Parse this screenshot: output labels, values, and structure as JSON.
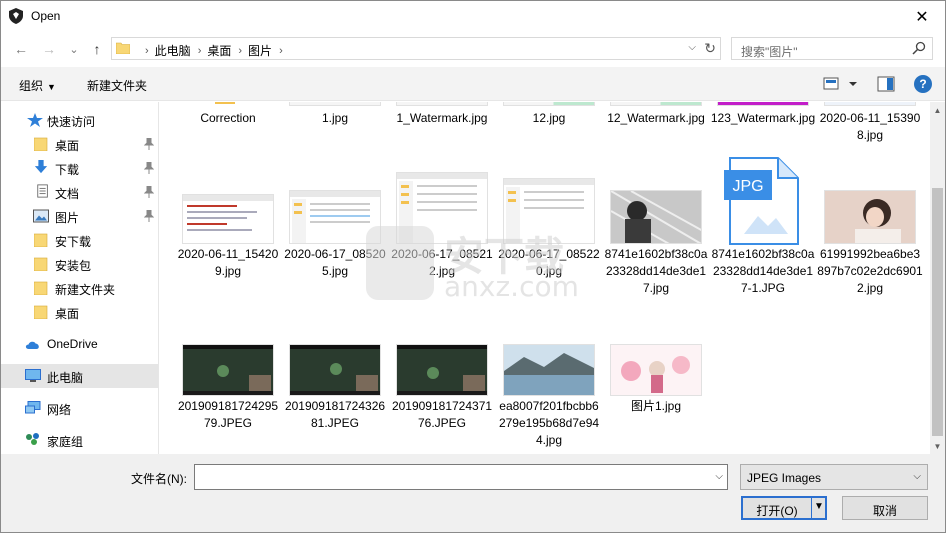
{
  "window": {
    "title": "Open",
    "close_glyph": "✕"
  },
  "nav": {
    "back_glyph": "←",
    "forward_glyph": "→",
    "recent_glyph": "⌄",
    "up_glyph": "↑",
    "breadcrumbs": [
      "此电脑",
      "桌面",
      "图片"
    ],
    "crumb_separator": "›",
    "search_placeholder": "搜索\"图片\""
  },
  "toolbar": {
    "organize_label": "组织",
    "new_folder_label": "新建文件夹",
    "help_label": "?"
  },
  "sidebar": {
    "items": [
      {
        "label": "快速访问",
        "icon": "star-icon",
        "pinned": false
      },
      {
        "label": "桌面",
        "icon": "folder-icon",
        "pinned": true
      },
      {
        "label": "下载",
        "icon": "download-icon",
        "pinned": true
      },
      {
        "label": "文档",
        "icon": "document-icon",
        "pinned": true
      },
      {
        "label": "图片",
        "icon": "pictures-icon",
        "pinned": true
      },
      {
        "label": "安下载",
        "icon": "folder-icon",
        "pinned": false
      },
      {
        "label": "安装包",
        "icon": "folder-icon",
        "pinned": false
      },
      {
        "label": "新建文件夹",
        "icon": "folder-icon",
        "pinned": false
      },
      {
        "label": "桌面",
        "icon": "folder-icon",
        "pinned": false
      },
      {
        "label": "OneDrive",
        "icon": "cloud-icon",
        "pinned": false
      },
      {
        "label": "此电脑",
        "icon": "computer-icon",
        "pinned": false,
        "selected": true
      },
      {
        "label": "网络",
        "icon": "network-icon",
        "pinned": false
      },
      {
        "label": "家庭组",
        "icon": "homegroup-icon",
        "pinned": false
      }
    ]
  },
  "files": {
    "row1": [
      "Correction",
      "1.jpg",
      "1_Watermark.jpg",
      "12.jpg",
      "12_Watermark.jpg",
      "123_Watermark.jpg",
      "2020-06-11_153908.jpg"
    ],
    "row2": [
      "2020-06-11_154209.jpg",
      "2020-06-17_085205.jpg",
      "2020-06-17_085212.jpg",
      "2020-06-17_085220.jpg",
      "8741e1602bf38c0a23328dd14de3de17.jpg",
      "8741e1602bf38c0a23328dd14de3de17-1.JPG",
      "61991992bea6be3897b7c02e2dc69012.jpg"
    ],
    "row3": [
      "20190918172429579.JPEG",
      "20190918172432681.JPEG",
      "20190918172437176.JPEG",
      "ea8007f201fbcbb6279e195b68d7e944.jpg",
      "图片1.jpg"
    ],
    "jpg_icon_label": "JPG"
  },
  "bottom": {
    "filename_label": "文件名(N):",
    "filename_value": "",
    "filetype_value": "JPEG Images",
    "open_label": "打开(O)",
    "cancel_label": "取消"
  },
  "watermark": {
    "cn": "安下载",
    "url": "anxz.com"
  },
  "colors": {
    "accent": "#2b6fcf",
    "help": "#2671c0",
    "folder": "#f8d775",
    "selected": "#e5e5e5"
  }
}
